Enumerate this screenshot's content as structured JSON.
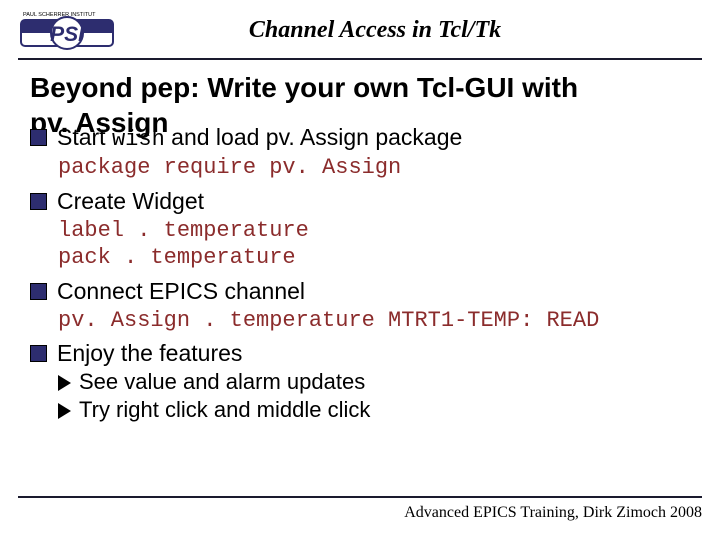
{
  "header": {
    "logo_upper": "PAUL SCHERRER INSTITUT",
    "logo_text": "PSI",
    "title": "Channel Access in Tcl/Tk"
  },
  "heading_line1": "Beyond pep: Write your own Tcl-GUI with",
  "heading_line2": "pv. Assign",
  "bullets": [
    {
      "pre": "Start ",
      "code": "wish",
      "post": " and load pv. Assign package",
      "code_block": "package require pv. Assign"
    },
    {
      "text": "Create Widget",
      "code_block": "label . temperature\npack . temperature"
    },
    {
      "text": "Connect EPICS channel",
      "code_block": "pv. Assign . temperature MTRT1-TEMP: READ"
    },
    {
      "text": "Enjoy the features",
      "subs": [
        "See value and alarm updates",
        "Try right click and middle click"
      ]
    }
  ],
  "footer": "Advanced EPICS Training, Dirk Zimoch 2008"
}
